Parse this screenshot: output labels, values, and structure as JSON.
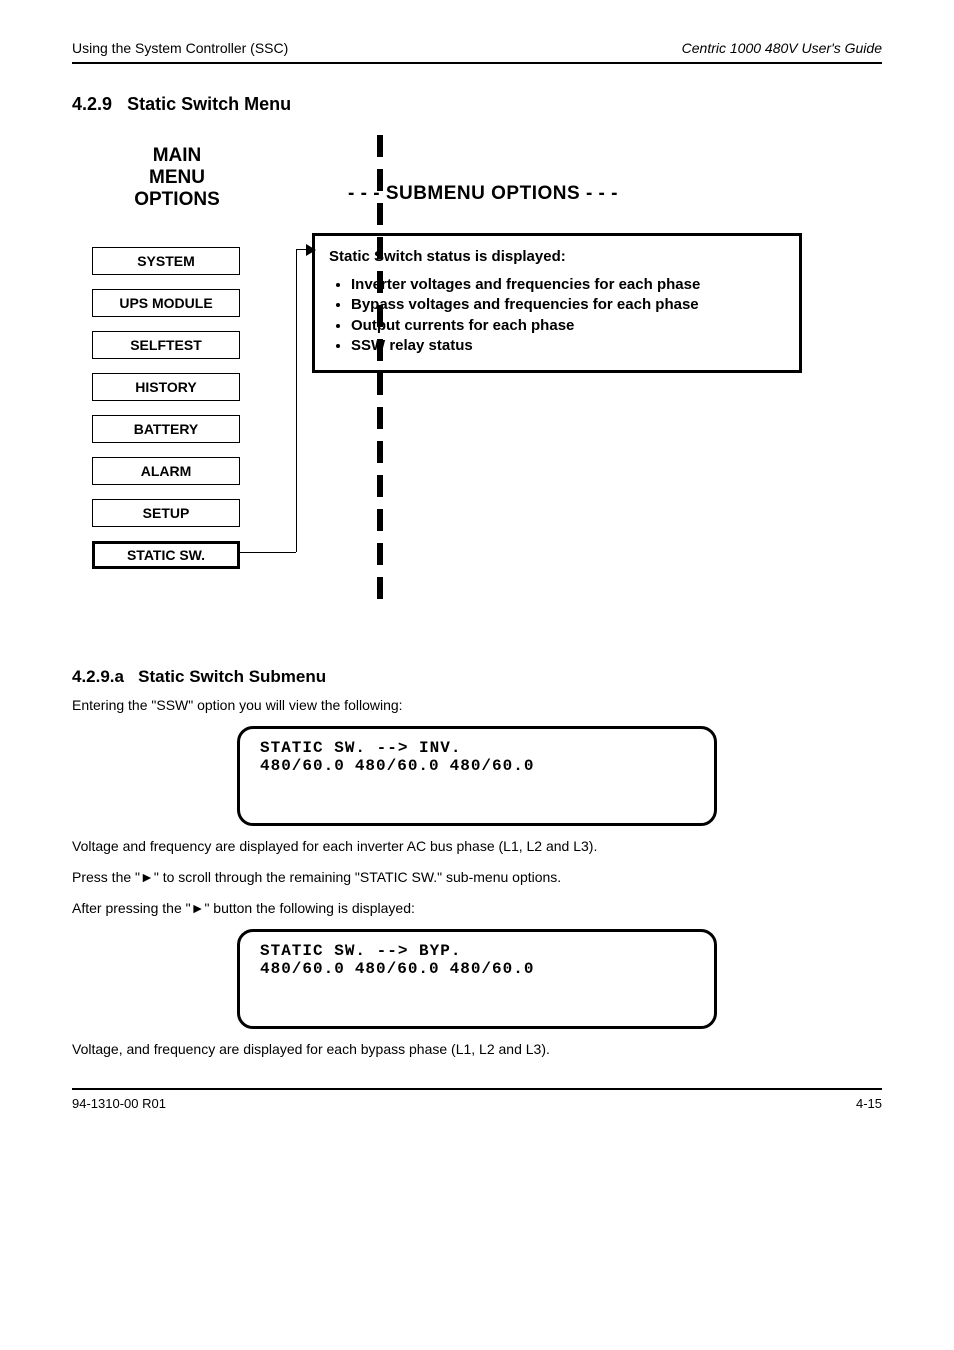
{
  "header": {
    "left": "Using the System Controller (SSC)",
    "right": "Centric 1000 480V User's Guide"
  },
  "section_no": "4.2.9",
  "section_title": "Static Switch Menu",
  "main_menu_label": "MAIN\nMENU\nOPTIONS",
  "menu_items": [
    "SYSTEM",
    "UPS MODULE",
    "SELFTEST",
    "HISTORY",
    "BATTERY",
    "ALARM",
    "SETUP",
    "STATIC SW."
  ],
  "submenu_header": "- - -    SUBMENU OPTIONS    - - -",
  "subbox": {
    "title": "Static Switch status is displayed:",
    "bullets": [
      "Inverter voltages and frequencies for each phase",
      "Bypass voltages and frequencies for each phase",
      "Output currents for each phase",
      "SSW relay status"
    ]
  },
  "sub_a": {
    "no": "4.2.9.a",
    "title": "Static Switch Submenu",
    "intro": "Entering the \"SSW\" option you will view the following:",
    "lcd1": {
      "line1": "STATIC SW. --> INV.",
      "line2": [
        "480/60.0",
        "480/60.0",
        "480/60.0"
      ]
    },
    "p1": "Voltage and frequency are displayed for each inverter AC bus phase (L1, L2 and L3).",
    "p2": "Press the \"►\" to scroll through the remaining \"STATIC SW.\" sub-menu options.",
    "p3": "After pressing the \"►\" button the following is displayed:",
    "lcd2": {
      "line1": "STATIC SW. --> BYP.",
      "line2": [
        "480/60.0",
        "480/60.0",
        "480/60.0"
      ]
    },
    "p4": "Voltage, and frequency are displayed for each bypass phase (L1, L2 and L3)."
  },
  "footer": {
    "left": "94-1310-00 R01",
    "right": "4-15"
  }
}
